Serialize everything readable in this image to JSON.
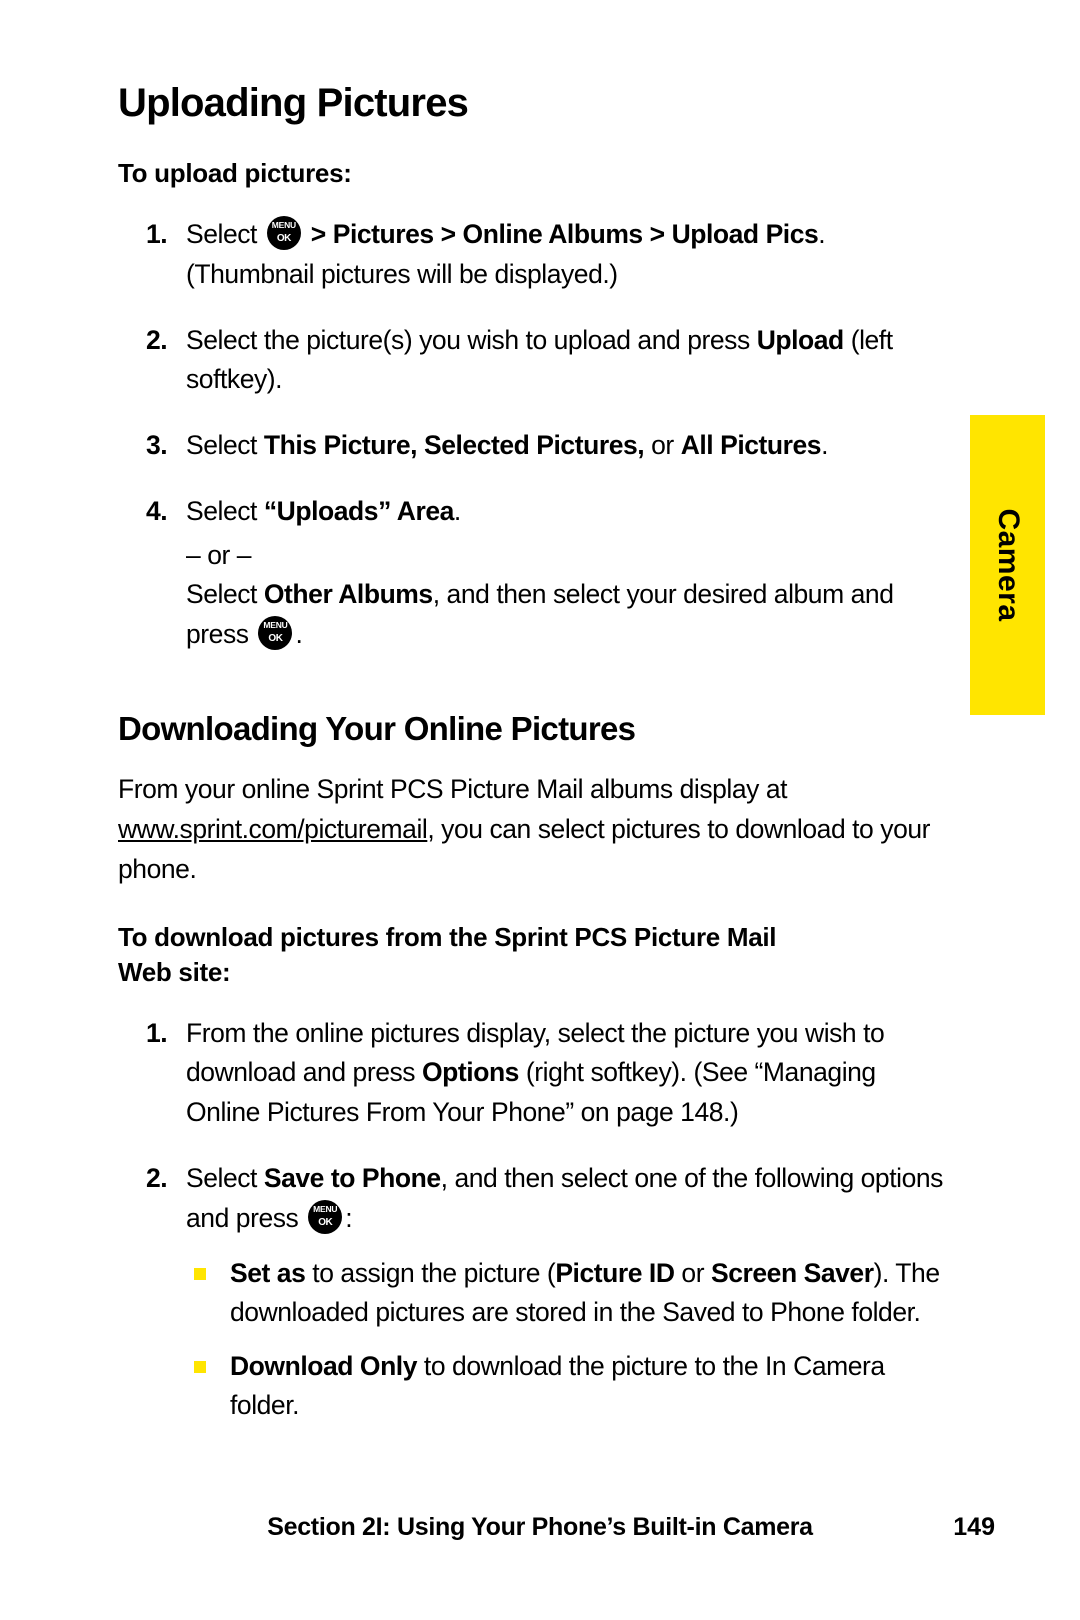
{
  "side_tab": {
    "label": "Camera",
    "color": "#ffe500"
  },
  "section1": {
    "heading": "Uploading Pictures",
    "intro": "To upload pictures:",
    "steps": [
      {
        "num": "1.",
        "pre": "Select",
        "post_bold": "> Pictures > Online Albums > Upload Pics",
        "post_rest": ".",
        "line2": "(Thumbnail pictures will be displayed.)"
      },
      {
        "num": "2.",
        "text_a": "Select the picture(s) you wish to upload and press ",
        "bold_b": "Upload",
        "text_c": " (left softkey)."
      },
      {
        "num": "3.",
        "text_a": "Select ",
        "bold_b": "This Picture, Selected Pictures,",
        "text_c": " or ",
        "bold_d": "All Pictures",
        "text_e": "."
      },
      {
        "num": "4.",
        "text_a": "Select ",
        "bold_b": "“Uploads” Area",
        "text_c": ".",
        "or": "– or –",
        "alt_a": "Select ",
        "alt_bold": "Other Albums",
        "alt_b": ", and then select your desired album and press",
        "alt_c": "."
      }
    ]
  },
  "section2": {
    "heading": "Downloading Your Online Pictures",
    "para_a": "From your online Sprint PCS Picture Mail albums display at ",
    "para_link": "www.sprint.com/picturemail",
    "para_b": ", you can select pictures to download to your phone.",
    "intro_line1": "To download pictures from the Sprint PCS Picture Mail",
    "intro_line2": "Web site:",
    "steps": [
      {
        "num": "1.",
        "text_a": "From the online pictures display, select the picture you wish to download and press ",
        "bold_b": "Options",
        "text_c": " (right softkey). (See “Managing Online Pictures From Your Phone” on page 148.)"
      },
      {
        "num": "2.",
        "text_a": "Select ",
        "bold_b": "Save to Phone",
        "text_c": ", and then select one of the following options and press",
        "text_d": ":",
        "bullets": [
          {
            "bold_a": "Set as",
            "text_b": " to assign the picture (",
            "bold_c": "Picture ID",
            "text_d": " or ",
            "bold_e": "Screen Saver",
            "text_f": "). The downloaded pictures are stored in the Saved to Phone folder."
          },
          {
            "bold_a": "Download Only",
            "text_b": " to download the picture to the In Camera folder."
          }
        ]
      }
    ]
  },
  "menu_key": {
    "top": "MENU",
    "bottom": "OK"
  },
  "footer": {
    "text": "Section 2I: Using Your Phone’s Built-in Camera",
    "page": "149"
  }
}
